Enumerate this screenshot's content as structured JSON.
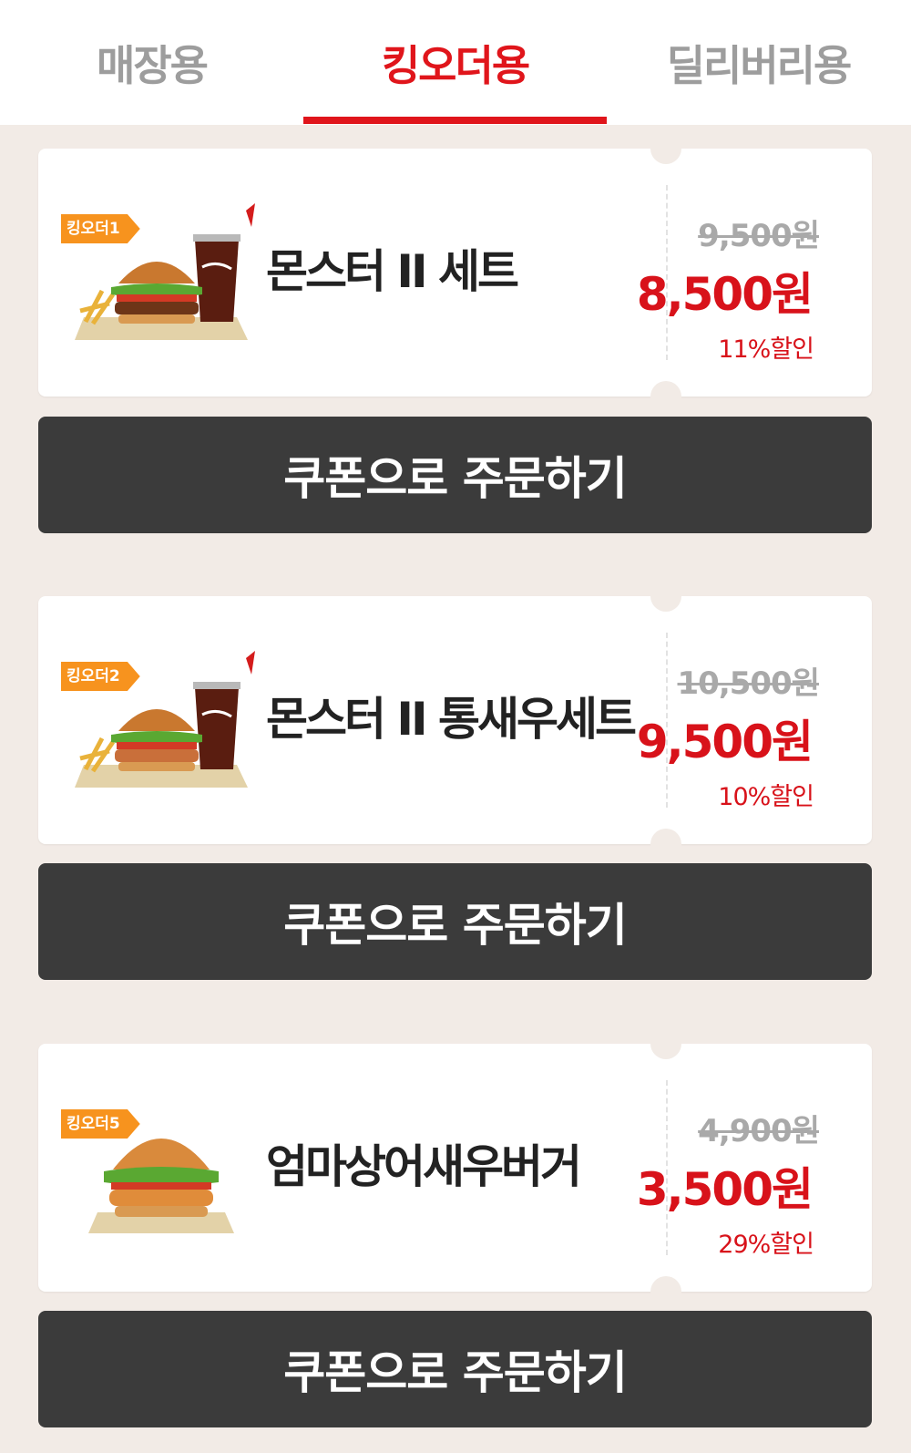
{
  "tabs": [
    {
      "label": "매장용",
      "active": false
    },
    {
      "label": "킹오더용",
      "active": true
    },
    {
      "label": "딜리버리용",
      "active": false
    }
  ],
  "coupons": [
    {
      "badge": "킹오더1",
      "name": "몬스터 II 세트",
      "original_price": "9,500원",
      "sale_price": "8,500원",
      "discount": "11%할인",
      "image": "burger-set-with-coke-and-fries",
      "button_label": "쿠폰으로 주문하기"
    },
    {
      "badge": "킹오더2",
      "name": "몬스터 II 통새우세트",
      "original_price": "10,500원",
      "sale_price": "9,500원",
      "discount": "10%할인",
      "image": "burger-set-with-coke-and-fries",
      "button_label": "쿠폰으로 주문하기"
    },
    {
      "badge": "킹오더5",
      "name": "엄마상어새우버거",
      "original_price": "4,900원",
      "sale_price": "3,500원",
      "discount": "29%할인",
      "image": "shrimp-burger",
      "button_label": "쿠폰으로 주문하기"
    }
  ],
  "colors": {
    "accent": "#e0151b",
    "badge": "#f7931e",
    "button": "#3b3b3b",
    "background": "#f2ebe6"
  }
}
